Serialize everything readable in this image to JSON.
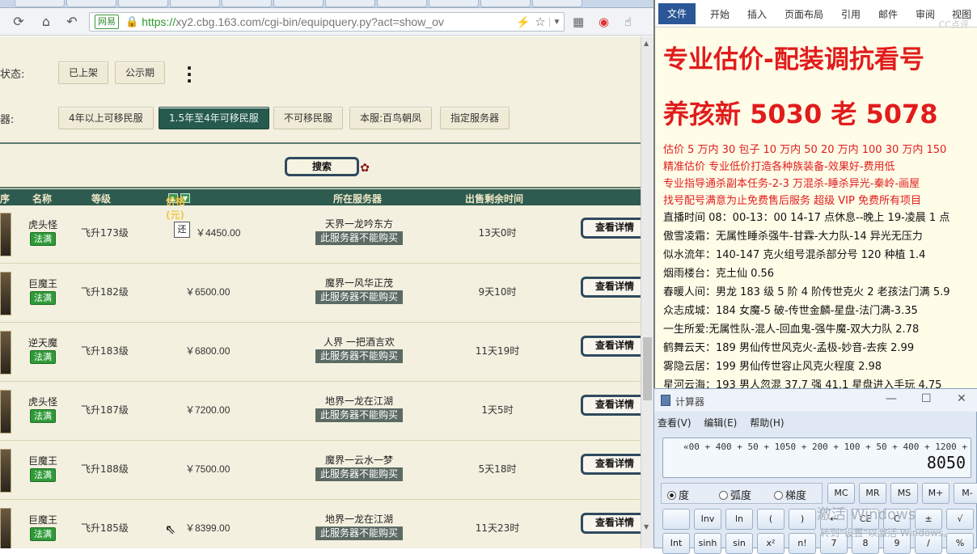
{
  "browser": {
    "url_provider": "网易",
    "url_secure": "https://",
    "url_host": "xy2.cbg.163.com",
    "url_path": "/cgi-bin/equipquery.py?act=show_ov"
  },
  "filters": {
    "status_label": "状态:",
    "status_buttons": [
      "已上架",
      "公示期"
    ],
    "server_label": "器:",
    "server_buttons": [
      "4年以上可移民服",
      "1.5年至4年可移民服",
      "不可移民服",
      "本服:百鸟朝凤",
      "指定服务器"
    ],
    "active_server_index": 1
  },
  "search_label": "搜索",
  "table": {
    "headers": [
      "序",
      "名称",
      "等级",
      "价格(元)",
      "所在服务器",
      "出售剩余时间"
    ],
    "rows": [
      {
        "name": "虎头怪",
        "school": "法满",
        "level": "飞升173级",
        "haggle": "还",
        "price": "￥4450.00",
        "server": "天界一龙吟东方",
        "note": "此服务器不能购买",
        "remain": "13天0时",
        "action": "查看详情"
      },
      {
        "name": "巨魔王",
        "school": "法满",
        "level": "飞升182级",
        "haggle": "",
        "price": "￥6500.00",
        "server": "魔界一风华正茂",
        "note": "此服务器不能购买",
        "remain": "9天10时",
        "action": "查看详情"
      },
      {
        "name": "逆天魔",
        "school": "法满",
        "level": "飞升183级",
        "haggle": "",
        "price": "￥6800.00",
        "server": "人界 一把酒言欢",
        "note": "此服务器不能购买",
        "remain": "11天19时",
        "action": "查看详情"
      },
      {
        "name": "虎头怪",
        "school": "法满",
        "level": "飞升187级",
        "haggle": "",
        "price": "￥7200.00",
        "server": "地界一龙在江湖",
        "note": "此服务器不能购买",
        "remain": "1天5时",
        "action": "查看详情"
      },
      {
        "name": "巨魔王",
        "school": "法满",
        "level": "飞升188级",
        "haggle": "",
        "price": "￥7500.00",
        "server": "魔界一云水一梦",
        "note": "此服务器不能购买",
        "remain": "5天18时",
        "action": "查看详情"
      },
      {
        "name": "巨魔王",
        "school": "法满",
        "level": "飞升185级",
        "haggle": "",
        "price": "￥8399.00",
        "server": "地界一龙在江湖",
        "note": "此服务器不能购买",
        "remain": "11天23时",
        "action": "查看详情"
      }
    ]
  },
  "word": {
    "tabs": [
      "文件",
      "开始",
      "插入",
      "页面布局",
      "引用",
      "邮件",
      "审阅",
      "视图"
    ],
    "watermark": "CC点评",
    "title1": "专业估价-配装调抗看号",
    "title2": "养孩新 5030 老 5078",
    "lines_red": [
      "估价 5 万内 30 包子   10 万内 50  20 万内 100  30 万内 150",
      "精准估价   专业低价打造各种族装备-效果好-费用低",
      "专业指导通杀副本任务-2-3 万混杀-睡杀异光-秦岭-画屋",
      "找号配号满意为止免费售后服务    超级 VIP 免费所有项目"
    ],
    "lines_black": [
      "直播时间 08：00-13：00  14-17 点休息--晚上 19-凌晨 1 点",
      "傲雪凌霜：无属性睡杀强牛-甘霖-大力队-14 异光无压力",
      "似水流年：140-147 克火组号混杀部分号 120 种植 1.4",
      "烟雨楼台：克土仙 0.56",
      "春暖人间：男龙 183 级 5 阶 4 阶传世克火 2 老孩法门满 5.9",
      "众志成城：184 女魔-5 破-传世金麟-星盘-法门满-3.35",
      "一生所爱:无属性队-混人-回血鬼-强牛魔-双大力队 2.78",
      "鹤舞云天：189 男仙传世风克火-孟极-妙音-去疾 2.99",
      "雾隐云居：199 男仙传世容止风克火程度 2.98",
      "星河云海：193 男人忽混 37.7 强 41.1 星盘进入手玩 4.75"
    ]
  },
  "calculator": {
    "title": "计算器",
    "menu": [
      "查看(V)",
      "编辑(E)",
      "帮助(H)"
    ],
    "expression": "«00 + 400 + 50 + 1050 + 200 + 100 + 50 + 400 + 1200 +",
    "result": "8050",
    "modes": [
      "度",
      "弧度",
      "梯度"
    ],
    "memory_keys": [
      "MC",
      "MR",
      "MS",
      "M+",
      "M-"
    ],
    "row2": [
      "",
      "Inv",
      "ln",
      "(",
      ")",
      "←",
      "CE",
      "C",
      "±",
      "√"
    ],
    "row3": [
      "Int",
      "sinh",
      "sin",
      "x²",
      "n!",
      "7",
      "8",
      "9",
      "/",
      "%"
    ]
  },
  "os": {
    "activate_title": "激活 Windows",
    "activate_sub": "转到\"设置\"以激活 Windows。"
  }
}
